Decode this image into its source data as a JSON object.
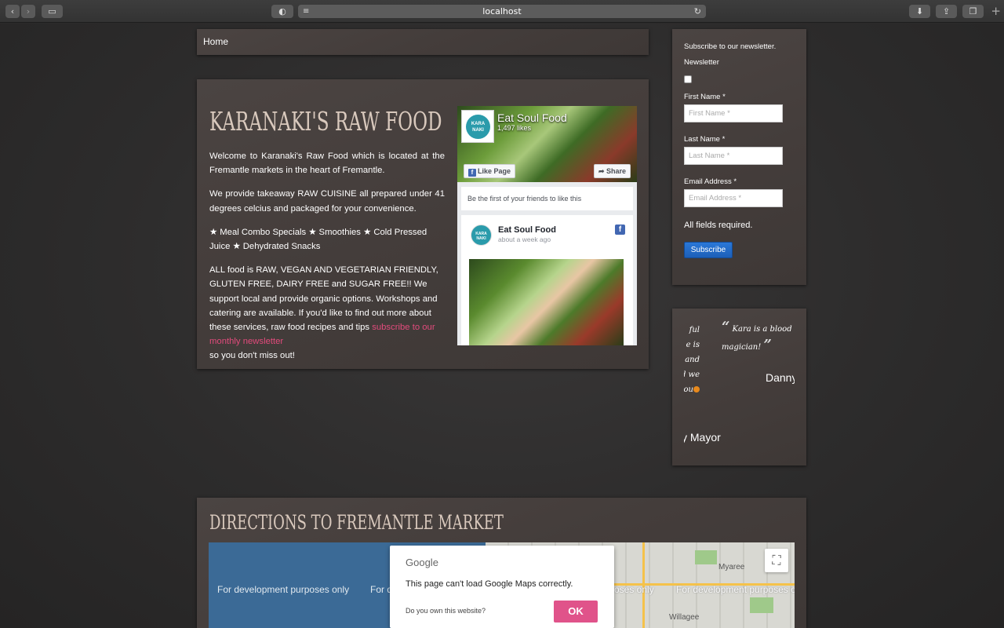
{
  "browser": {
    "address": "localhost"
  },
  "nav": {
    "home": "Home"
  },
  "main": {
    "title": "KARANAKI'S RAW FOOD",
    "p1": "Welcome to Karanaki's Raw Food which is located at the Fremantle markets in the heart of Fremantle.",
    "p2": "We provide takeaway RAW CUISINE all prepared under 41 degrees celcius and packaged for your convenience.",
    "p3": "★ Meal Combo Specials ★ Smoothies ★ Cold Pressed Juice ★ Dehydrated Snacks",
    "p4_text": "ALL food is RAW, VEGAN AND VEGETARIAN FRIENDLY, GLUTEN FREE, DAIRY FREE and SUGAR FREE!! We support local and provide organic options. Workshops and catering are available. If you'd like to find out more about these services, raw food recipes and tips ",
    "p4_link": "subscribe to our monthly newsletter",
    "p4_end": "so you don't miss out!"
  },
  "facebook": {
    "page_name": "Eat Soul Food",
    "likes": "1,497 likes",
    "like_button": "Like Page",
    "share_button": "Share",
    "friends_text": "Be the first of your friends to like this",
    "post_name": "Eat Soul Food",
    "post_time": "about a week ago",
    "logo_text_1": "KARA",
    "logo_text_2": "NAKI"
  },
  "newsletter": {
    "heading": "Subscribe to our newsletter.",
    "newsletter_label": "Newsletter",
    "first_name_label": "First Name *",
    "first_name_placeholder": "First Name *",
    "last_name_label": "Last Name *",
    "last_name_placeholder": "Last Name *",
    "email_label": "Email Address *",
    "email_placeholder": "Email Address *",
    "required_note": "All fields required.",
    "subscribe_button": "Subscribe"
  },
  "testimonials": {
    "left_fragment_lines": [
      "ful",
      "e is",
      "me and",
      "it and we",
      "ank you"
    ],
    "quote_open": "“",
    "quote_text": "Kara is a blood magician!",
    "quote_close": "”",
    "author": "Danny",
    "prev_author": "y Mayor"
  },
  "directions": {
    "title": "DIRECTIONS TO FREMANTLE MARKET",
    "dev_text": "For development purposes only",
    "dev_text_partial_1": "For d",
    "dev_text_partial_2": "oses only",
    "dev_text_partial_3": "For development purposes on",
    "place_1": "Myaree",
    "place_2": "Willagee"
  },
  "google_dialog": {
    "brand": "Google",
    "message": "This page can't load Google Maps correctly.",
    "own_site": "Do you own this website?",
    "ok_button": "OK"
  }
}
